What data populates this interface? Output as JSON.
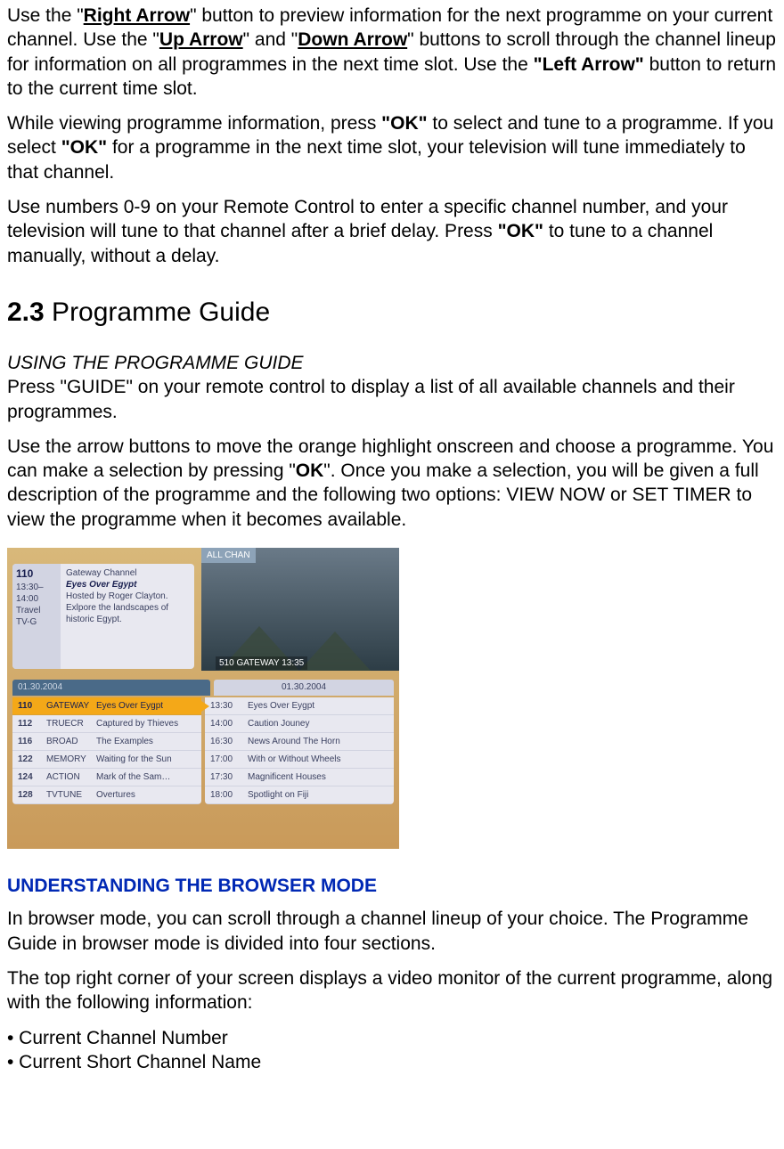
{
  "para1": {
    "t1": "Use the \"",
    "b1": "Right Arrow",
    "t2": "\" button to preview information for the next programme on your current channel. Use the \"",
    "b2": "Up Arrow",
    "t3": "\" and \"",
    "b3": "Down Arrow",
    "t4": "\"   buttons to scroll through the channel lineup for information on all programmes in the next time slot. Use the ",
    "b4": "\"Left Arrow\"",
    "t5": " button to return to the current time slot."
  },
  "para2": {
    "t1": "While viewing programme information, press ",
    "b1": "\"OK\"",
    "t2": " to select and tune to a programme. If you select ",
    "b2": "\"OK\"",
    "t3": " for a programme in the next time slot, your television will tune immediately to that channel."
  },
  "para3": {
    "t1": "Use numbers 0-9 on your Remote Control to enter a specific channel number, and your television will tune to that channel after a brief delay.   Press ",
    "b1": "\"OK\"",
    "t2": " to tune to a channel manually, without a delay."
  },
  "section": {
    "num": "2.3",
    "title": " Programme Guide"
  },
  "sub1": "USING THE PROGRAMME GUIDE",
  "para4": "Press \"GUIDE\" on your remote control to display a list of all available channels and their programmes.",
  "para5": {
    "t1": "Use the arrow buttons to move the orange highlight onscreen and choose a programme. You can make a selection by pressing \"",
    "b1": "OK",
    "t2": "\". Once you make a selection, you will be given a full description of the programme and the following two options: VIEW NOW or SET TIMER to view the programme when it becomes available."
  },
  "guide": {
    "allchan": "ALL CHAN",
    "video_label": "510   GATEWAY   13:35",
    "info": {
      "chnum": "110",
      "time1": "13:30–",
      "time2": "14:00",
      "genre": "Travel",
      "rating": "TV-G",
      "channel": "Gateway Channel",
      "title": "Eyes Over Egypt",
      "desc": "Hosted by Roger Clayton. Exlpore the landscapes of historic Egypt."
    },
    "date_left": "01.30.2004",
    "date_right": "01.30.2004",
    "left": [
      {
        "num": "110",
        "short": "GATEWAY",
        "prog": "Eyes Over Eygpt",
        "hl": true
      },
      {
        "num": "112",
        "short": "TRUECR",
        "prog": "Captured by Thieves"
      },
      {
        "num": "116",
        "short": "BROAD",
        "prog": "The Examples"
      },
      {
        "num": "122",
        "short": "MEMORY",
        "prog": "Waiting for the Sun"
      },
      {
        "num": "124",
        "short": "ACTION",
        "prog": "Mark of the Sam…"
      },
      {
        "num": "128",
        "short": "TVTUNE",
        "prog": "Overtures"
      }
    ],
    "right": [
      {
        "time": "13:30",
        "prog": "Eyes Over Eygpt"
      },
      {
        "time": "14:00",
        "prog": "Caution Jouney"
      },
      {
        "time": "16:30",
        "prog": "News Around The Horn"
      },
      {
        "time": "17:00",
        "prog": "With or Without Wheels"
      },
      {
        "time": "17:30",
        "prog": "Magnificent Houses"
      },
      {
        "time": "18:00",
        "prog": "Spotlight on Fiji"
      }
    ]
  },
  "sub2": "UNDERSTANDING THE BROWSER MODE",
  "para6": "In browser mode, you can scroll through a channel lineup of your choice.   The Programme Guide in browser mode is divided into four sections.",
  "para7": "The top right corner of your screen displays a video monitor of the current programme, along with the following information:",
  "bullets": {
    "b1": "• Current Channel Number",
    "b2": "• Current Short Channel Name"
  }
}
